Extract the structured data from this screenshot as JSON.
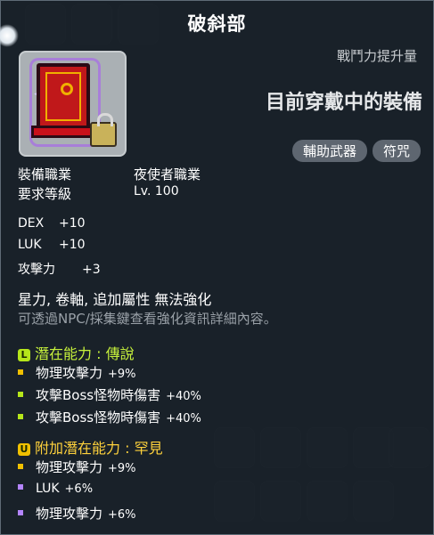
{
  "title": "破斜部",
  "header": {
    "combat_label": "戰鬥力提升量",
    "equipped_label": "目前穿戴中的裝備",
    "tags": [
      "輔助武器",
      "符咒"
    ]
  },
  "requirements": {
    "job_label": "裝備職業",
    "job_value": "夜使者職業",
    "level_label": "要求等級",
    "level_value": "Lv. 100"
  },
  "stats": [
    {
      "name": "DEX",
      "value": "+10"
    },
    {
      "name": "LUK",
      "value": "+10"
    },
    {
      "name": "攻擊力",
      "value": "+3"
    }
  ],
  "notes": {
    "restriction": "星力, 卷軸, 追加屬性 無法強化",
    "info": "可透過NPC/採集鍵查看強化資訊詳細內容。"
  },
  "potential": {
    "badge": "L",
    "label": "潛在能力 : 傳說",
    "lines": [
      {
        "text": "物理攻擊力",
        "value": "+9%"
      },
      {
        "text": "攻擊Boss怪物時傷害",
        "value": "+40%"
      },
      {
        "text": "攻擊Boss怪物時傷害",
        "value": "+40%"
      }
    ]
  },
  "additional": {
    "badge": "U",
    "label": "附加潛在能力 : 罕見",
    "lines": [
      {
        "text": "物理攻擊力",
        "value": "+9%"
      },
      {
        "text": "LUK",
        "value": "+6%"
      },
      {
        "text": "物理攻擊力",
        "value": "+6%"
      }
    ]
  }
}
